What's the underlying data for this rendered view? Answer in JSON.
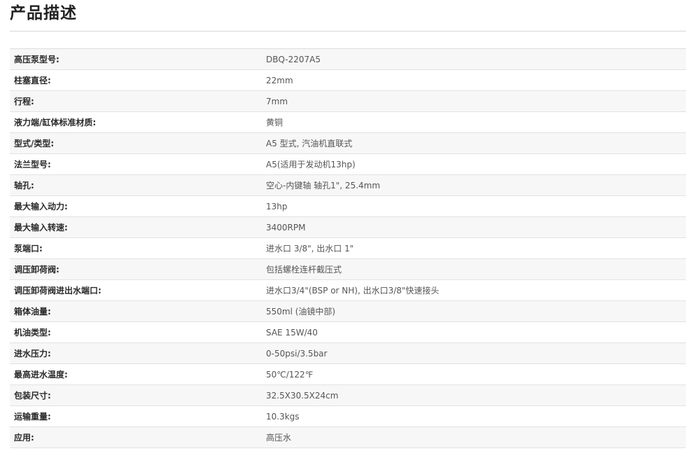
{
  "section_title": "产品描述",
  "specs": [
    {
      "label": "高压泵型号:",
      "value": "DBQ-2207A5"
    },
    {
      "label": "柱塞直径:",
      "value": "22mm"
    },
    {
      "label": "行程:",
      "value": "7mm"
    },
    {
      "label": "液力端/缸体标准材质:",
      "value": "黄铜"
    },
    {
      "label": "型式/类型:",
      "value": "A5 型式, 汽油机直联式"
    },
    {
      "label": "法兰型号:",
      "value": "A5(适用于发动机13hp)"
    },
    {
      "label": "轴孔:",
      "value": "空心-内键轴  轴孔1\", 25.4mm"
    },
    {
      "label": "最大输入动力:",
      "value": "13hp"
    },
    {
      "label": "最大输入转速:",
      "value": "3400RPM"
    },
    {
      "label": "泵端口:",
      "value": "进水口 3/8\", 出水口 1\""
    },
    {
      "label": "调压卸荷阀:",
      "value": "包括螺栓连杆截压式"
    },
    {
      "label": "调压卸荷阀进出水端口:",
      "value": "进水口3/4\"(BSP or NH), 出水口3/8\"快速接头"
    },
    {
      "label": "箱体油量:",
      "value": "550ml (油镜中部)"
    },
    {
      "label": "机油类型:",
      "value": "SAE 15W/40"
    },
    {
      "label": "进水压力:",
      "value": "0-50psi/3.5bar"
    },
    {
      "label": "最高进水温度:",
      "value": "50℃/122℉"
    },
    {
      "label": "包装尺寸:",
      "value": "32.5X30.5X24cm"
    },
    {
      "label": "运输重量:",
      "value": "10.3kgs"
    },
    {
      "label": "应用:",
      "value": "高压水"
    }
  ]
}
